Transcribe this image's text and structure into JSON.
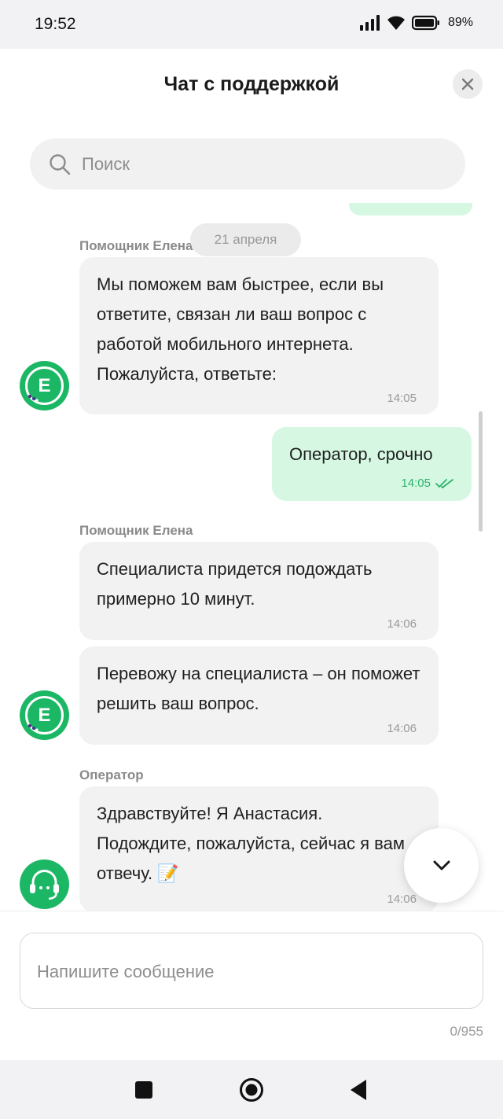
{
  "status_bar": {
    "time": "19:52",
    "battery": "89%"
  },
  "header": {
    "title": "Чат с поддержкой"
  },
  "search": {
    "placeholder": "Поиск"
  },
  "chat": {
    "date_separator": "21 апреля",
    "messages": [
      {
        "sender": "Помощник Елена",
        "text": "Мы поможем вам быстрее, если вы ответите, связан ли ваш вопрос с работой мобильного интернета. Пожалуйста, ответьте:",
        "time": "14:05",
        "direction": "incoming"
      },
      {
        "text": "Оператор, срочно",
        "time": "14:05",
        "direction": "outgoing",
        "status": "read"
      },
      {
        "sender": "Помощник Елена",
        "text": "Специалиста придется подождать примерно 10 минут.",
        "time": "14:06",
        "direction": "incoming"
      },
      {
        "text": "Перевожу на специалиста – он поможет решить ваш вопрос.",
        "time": "14:06",
        "direction": "incoming"
      },
      {
        "sender": "Оператор",
        "text": "Здравствуйте! Я Анастасия. Подождите, пожалуйста, сейчас я вам отвечу. 📝",
        "time": "14:06",
        "direction": "incoming"
      }
    ],
    "avatars": {
      "assistant_letter": "Е"
    }
  },
  "composer": {
    "placeholder": "Напишите сообщение",
    "counter": "0/955"
  },
  "colors": {
    "accent": "#1cb765",
    "outgoing_bubble": "#d6f8e3",
    "incoming_bubble": "#f2f2f2"
  }
}
